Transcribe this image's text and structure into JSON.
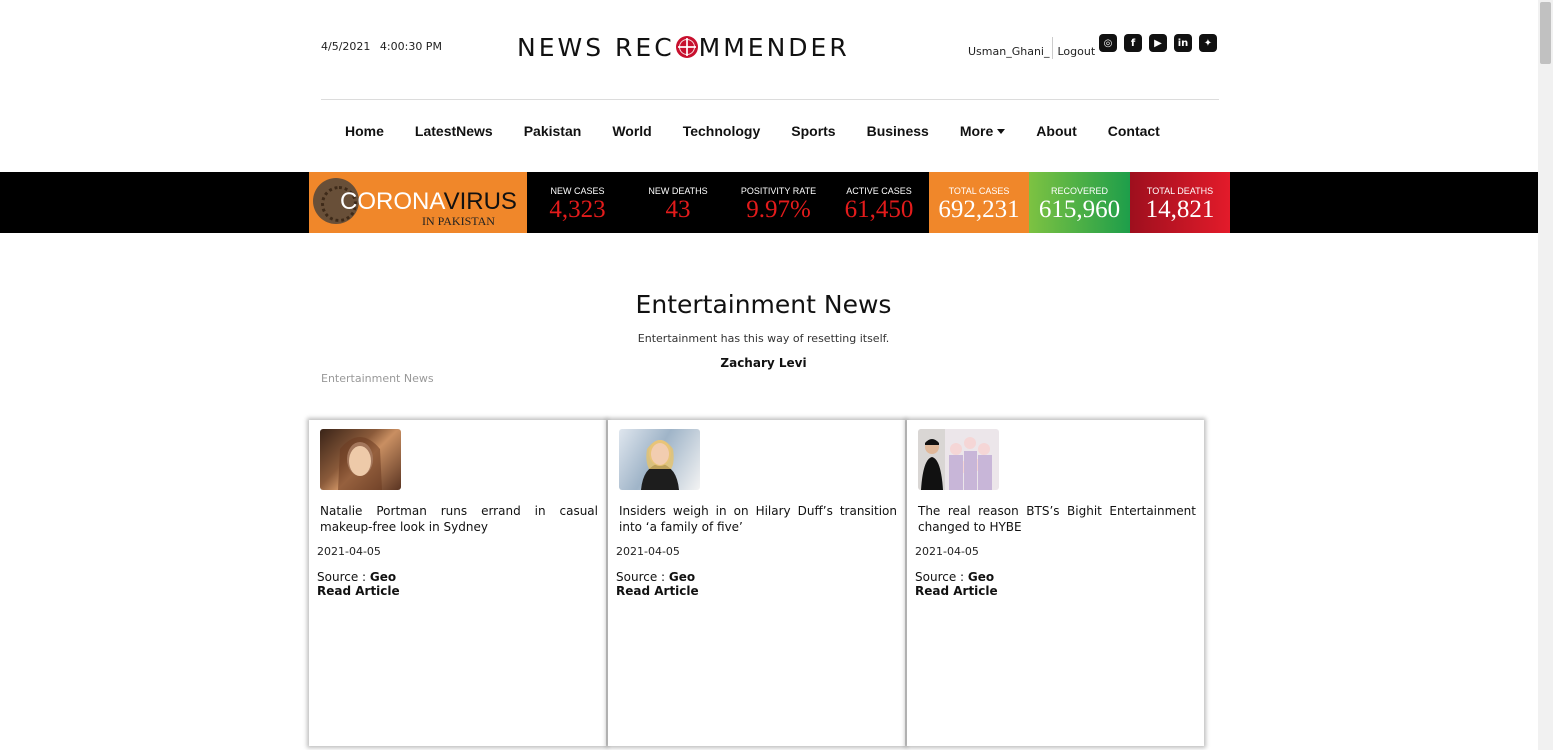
{
  "header": {
    "date": "4/5/2021",
    "time": "4:00:30 PM",
    "logo_left": "NEWS REC",
    "logo_right": "MMENDER",
    "username": "Usman_Ghani_",
    "logout": "Logout",
    "social_icons": [
      "instagram-icon",
      "facebook-icon",
      "youtube-icon",
      "linkedin-icon",
      "twitter-icon"
    ]
  },
  "nav": {
    "items": [
      "Home",
      "LatestNews",
      "Pakistan",
      "World",
      "Technology",
      "Sports",
      "Business",
      "More",
      "About",
      "Contact"
    ]
  },
  "covid": {
    "brand_a": "CORONA",
    "brand_b": "VIRUS",
    "brand_sub": "IN PAKISTAN",
    "stats": [
      {
        "label": "NEW CASES",
        "value": "4,323",
        "bg": "#2c2c2c"
      },
      {
        "label": "NEW DEATHS",
        "value": "43",
        "bg": "#2c2c2c"
      },
      {
        "label": "POSITIVITY RATE",
        "value": "9.97%",
        "bg": "#2c2c2c"
      },
      {
        "label": "ACTIVE CASES",
        "value": "61,450",
        "bg": "#2c2c2c"
      },
      {
        "label": "TOTAL CASES",
        "value": "692,231",
        "bg": "#f0872a"
      },
      {
        "label": "RECOVERED",
        "value": "615,960",
        "bg": "#3aa64a"
      },
      {
        "label": "TOTAL DEATHS",
        "value": "14,821",
        "bg": "#c8102e"
      }
    ]
  },
  "section": {
    "title": "Entertainment News",
    "quote": "Entertainment has this way of resetting itself.",
    "author": "Zachary Levi",
    "breadcrumb": "Entertainment News"
  },
  "articles": [
    {
      "title": "Natalie Portman runs errand in casual makeup-free look in Sydney",
      "date": "2021-04-05",
      "source_label": "Source : ",
      "source": "Geo",
      "read": "Read Article"
    },
    {
      "title": "Insiders weigh in on Hilary Duff’s transition into ‘a family of five’",
      "date": "2021-04-05",
      "source_label": "Source : ",
      "source": "Geo",
      "read": "Read Article"
    },
    {
      "title": "The real reason BTS’s Bighit Entertainment changed to HYBE",
      "date": "2021-04-05",
      "source_label": "Source : ",
      "source": "Geo",
      "read": "Read Article"
    }
  ]
}
